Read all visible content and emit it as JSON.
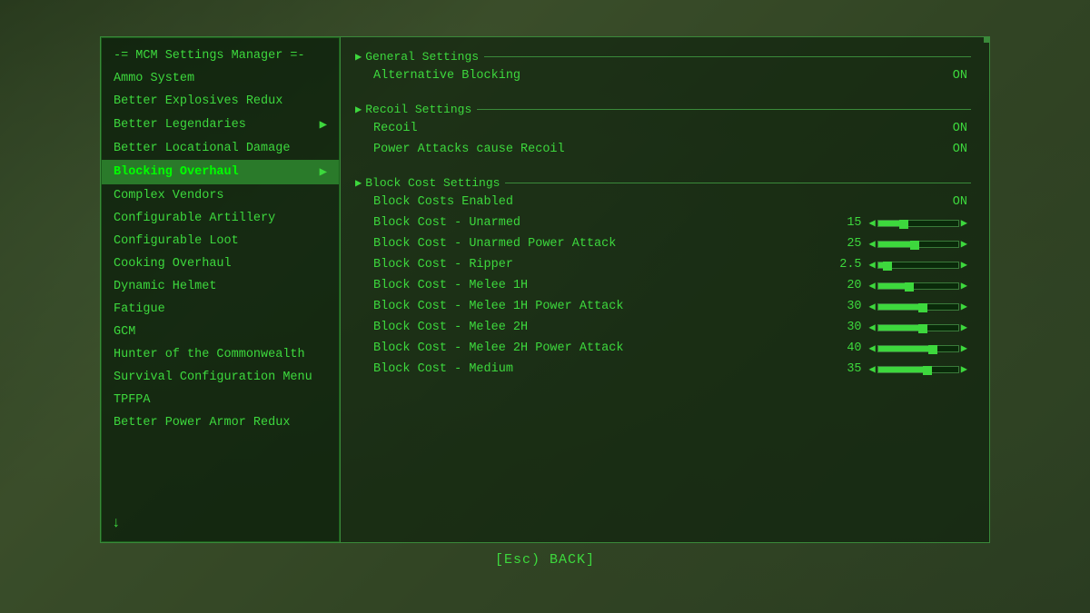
{
  "sidebar": {
    "header": "-= MCM Settings Manager =-",
    "items": [
      {
        "id": "ammo-system",
        "label": "Ammo System",
        "active": false
      },
      {
        "id": "better-explosives",
        "label": "Better Explosives Redux",
        "active": false
      },
      {
        "id": "better-legendaries",
        "label": "Better Legendaries",
        "active": false,
        "arrow": true
      },
      {
        "id": "better-locational",
        "label": "Better Locational Damage",
        "active": false
      },
      {
        "id": "blocking-overhaul",
        "label": "Blocking Overhaul",
        "active": true,
        "arrow": true
      },
      {
        "id": "complex-vendors",
        "label": "Complex Vendors",
        "active": false
      },
      {
        "id": "configurable-artillery",
        "label": "Configurable Artillery",
        "active": false
      },
      {
        "id": "configurable-loot",
        "label": "Configurable Loot",
        "active": false
      },
      {
        "id": "cooking-overhaul",
        "label": "Cooking Overhaul",
        "active": false
      },
      {
        "id": "dynamic-helmet",
        "label": "Dynamic Helmet",
        "active": false
      },
      {
        "id": "fatigue",
        "label": "Fatigue",
        "active": false
      },
      {
        "id": "gcm",
        "label": "GCM",
        "active": false
      },
      {
        "id": "hunter-commonwealth",
        "label": "Hunter of the Commonwealth",
        "active": false
      },
      {
        "id": "survival-config",
        "label": "Survival Configuration Menu",
        "active": false
      },
      {
        "id": "tpfpa",
        "label": "TPFPA",
        "active": false
      },
      {
        "id": "better-power-armor",
        "label": "Better Power Armor Redux",
        "active": false
      }
    ]
  },
  "right_panel": {
    "sections": [
      {
        "id": "general-settings",
        "title": "General Settings",
        "settings": [
          {
            "id": "alt-blocking",
            "label": "Alternative Blocking",
            "type": "toggle",
            "value": "ON"
          }
        ]
      },
      {
        "id": "recoil-settings",
        "title": "Recoil Settings",
        "settings": [
          {
            "id": "recoil",
            "label": "Recoil",
            "type": "toggle",
            "value": "ON"
          },
          {
            "id": "power-attacks-recoil",
            "label": "Power Attacks cause Recoil",
            "type": "toggle",
            "value": "ON"
          }
        ]
      },
      {
        "id": "block-cost-settings",
        "title": "Block Cost Settings",
        "settings": [
          {
            "id": "block-costs-enabled",
            "label": "Block Costs Enabled",
            "type": "toggle",
            "value": "ON"
          },
          {
            "id": "block-cost-unarmed",
            "label": "Block Cost - Unarmed",
            "type": "slider",
            "value": "15",
            "fill_pct": 28
          },
          {
            "id": "block-cost-unarmed-power",
            "label": "Block Cost - Unarmed Power Attack",
            "type": "slider",
            "value": "25",
            "fill_pct": 42
          },
          {
            "id": "block-cost-ripper",
            "label": "Block Cost - Ripper",
            "type": "slider",
            "value": "2.5",
            "fill_pct": 8
          },
          {
            "id": "block-cost-melee-1h",
            "label": "Block Cost - Melee 1H",
            "type": "slider",
            "value": "20",
            "fill_pct": 35
          },
          {
            "id": "block-cost-melee-1h-power",
            "label": "Block Cost - Melee 1H Power Attack",
            "type": "slider",
            "value": "30",
            "fill_pct": 52
          },
          {
            "id": "block-cost-melee-2h",
            "label": "Block Cost - Melee 2H",
            "type": "slider",
            "value": "30",
            "fill_pct": 52
          },
          {
            "id": "block-cost-melee-2h-power",
            "label": "Block Cost - Melee 2H Power Attack",
            "type": "slider",
            "value": "40",
            "fill_pct": 65
          },
          {
            "id": "block-cost-medium",
            "label": "Block Cost - Medium",
            "type": "slider",
            "value": "35",
            "fill_pct": 58
          }
        ]
      }
    ]
  },
  "bottom": {
    "back_label": "[Esc) BACK]"
  },
  "colors": {
    "accent": "#3dd83d",
    "bg_dark": "#0a1a0a",
    "panel_bg": "rgba(10,30,10,0.75)"
  }
}
